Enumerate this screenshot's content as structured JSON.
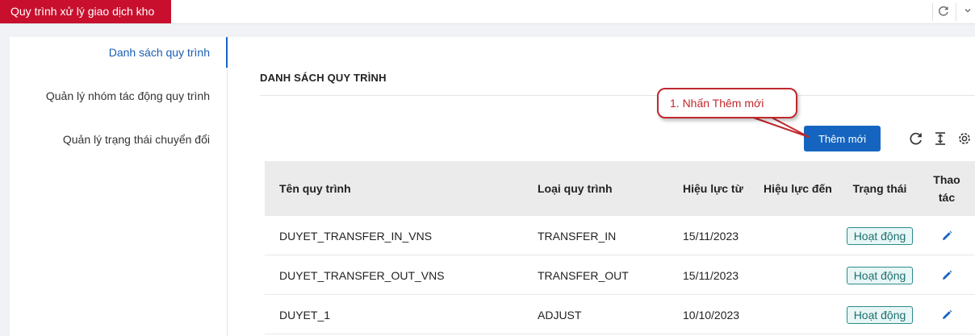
{
  "header": {
    "active_tab": "Quy trình xử lý giao dịch kho",
    "refresh_icon": "refresh-icon",
    "menu_icon": "chevron-down-icon"
  },
  "sidebar": {
    "items": [
      {
        "label": "Danh sách quy trình",
        "active": true
      },
      {
        "label": "Quản lý nhóm tác động quy trình",
        "active": false
      },
      {
        "label": "Quản lý trạng thái chuyển đổi",
        "active": false
      }
    ]
  },
  "main": {
    "title": "DANH SÁCH QUY TRÌNH",
    "add_button_label": "Thêm mới",
    "toolbar_icons": [
      "refresh-icon",
      "column-height-icon",
      "settings-icon"
    ]
  },
  "table": {
    "columns": [
      "Tên quy trình",
      "Loại quy trình",
      "Hiệu lực từ",
      "Hiệu lực đến",
      "Trạng thái",
      "Thao tác"
    ],
    "rows": [
      {
        "name": "DUYET_TRANSFER_IN_VNS",
        "type": "TRANSFER_IN",
        "from": "15/11/2023",
        "to": "",
        "status": "Hoạt động"
      },
      {
        "name": "DUYET_TRANSFER_OUT_VNS",
        "type": "TRANSFER_OUT",
        "from": "15/11/2023",
        "to": "",
        "status": "Hoạt động"
      },
      {
        "name": "DUYET_1",
        "type": "ADJUST",
        "from": "10/10/2023",
        "to": "",
        "status": "Hoạt động"
      }
    ]
  },
  "annotation": {
    "text": "1. Nhấn Thêm mới"
  },
  "colors": {
    "brand_red": "#c8102e",
    "primary_blue": "#1565c0",
    "status_teal": "#2e8b8b",
    "annotation_red": "#c0282d"
  }
}
